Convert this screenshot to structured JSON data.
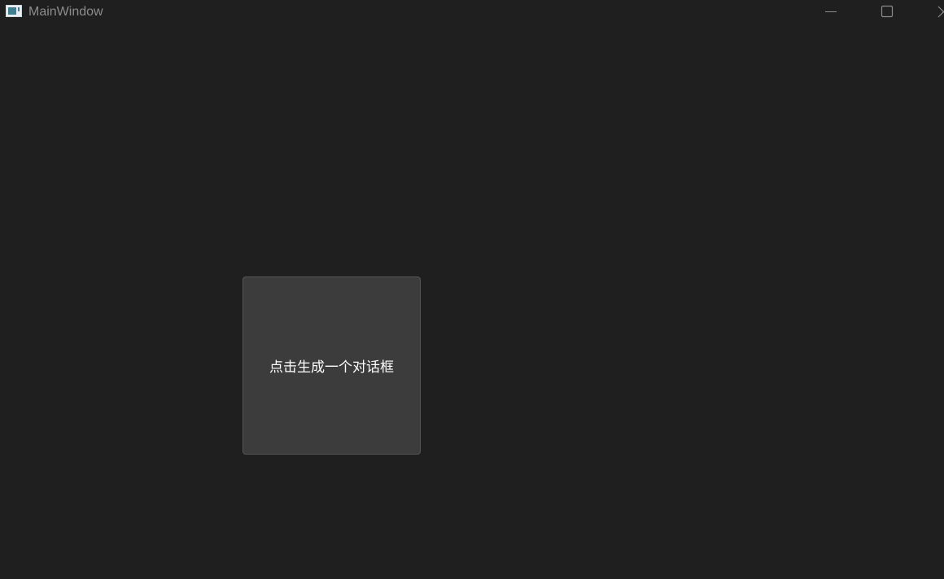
{
  "window": {
    "title": "MainWindow",
    "icon": "app-window-icon",
    "controls": [
      "minimize-icon",
      "maximize-icon",
      "close-icon"
    ],
    "background": "#1f1f1f"
  },
  "main": {
    "button_label": "点击生成一个对话框",
    "button_background": "#3c3c3c",
    "button_text_color": "#ffffff"
  }
}
